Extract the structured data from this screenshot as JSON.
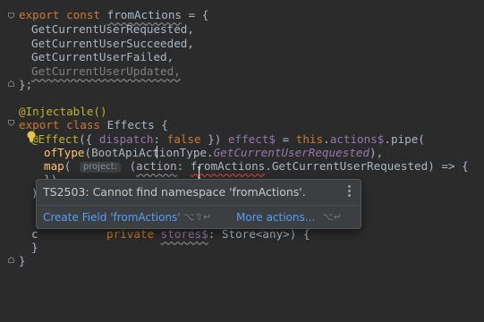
{
  "code": {
    "l1": {
      "kw1": "export",
      "kw2": "const",
      "name": "fromActions",
      "rest": " = {"
    },
    "l2": "GetCurrentUserRequested,",
    "l3": "GetCurrentUserSucceeded,",
    "l4": "GetCurrentUserFailed,",
    "l5": "GetCurrentUserUpdated,",
    "l6": "};",
    "l8": "@Injectable()",
    "l9": {
      "kw1": "export",
      "kw2": "class",
      "name": "Effects {"
    },
    "l10": {
      "dec": "@Effect",
      "a": "({ ",
      "prop": "dispatch",
      "b": ": ",
      "kw": "false",
      "c": " }) ",
      "fx": "effect$",
      "d": " = ",
      "this": "this",
      "e": ".",
      "act": "actions$",
      "f": ".pipe("
    },
    "l11": {
      "fn": "ofType",
      "a": "(",
      "type": "BootApiActionType",
      "b": ".",
      "member": "GetCurrentUserRequested",
      "c": "),"
    },
    "l12": {
      "fn": "map",
      "a": "( ",
      "hint": "project:",
      "b": " (",
      "param": "action",
      "c": ": ",
      "ns": "fromActions",
      "d": ".GetCurrentUserRequested) => {"
    },
    "l13": "})",
    "l14": ")",
    "l16": "c",
    "l17": {
      "kw": "private",
      "sp": " ",
      "name": "stores$",
      "rest": ": Store<any>) {"
    },
    "l18": "}",
    "l19": "}"
  },
  "popup": {
    "message": "TS2503: Cannot find namespace 'fromActions'.",
    "action1": "Create Field 'fromActions'",
    "shortcut1": "⌥⇧↵",
    "action2": "More actions...",
    "shortcut2": "⌥↵"
  }
}
